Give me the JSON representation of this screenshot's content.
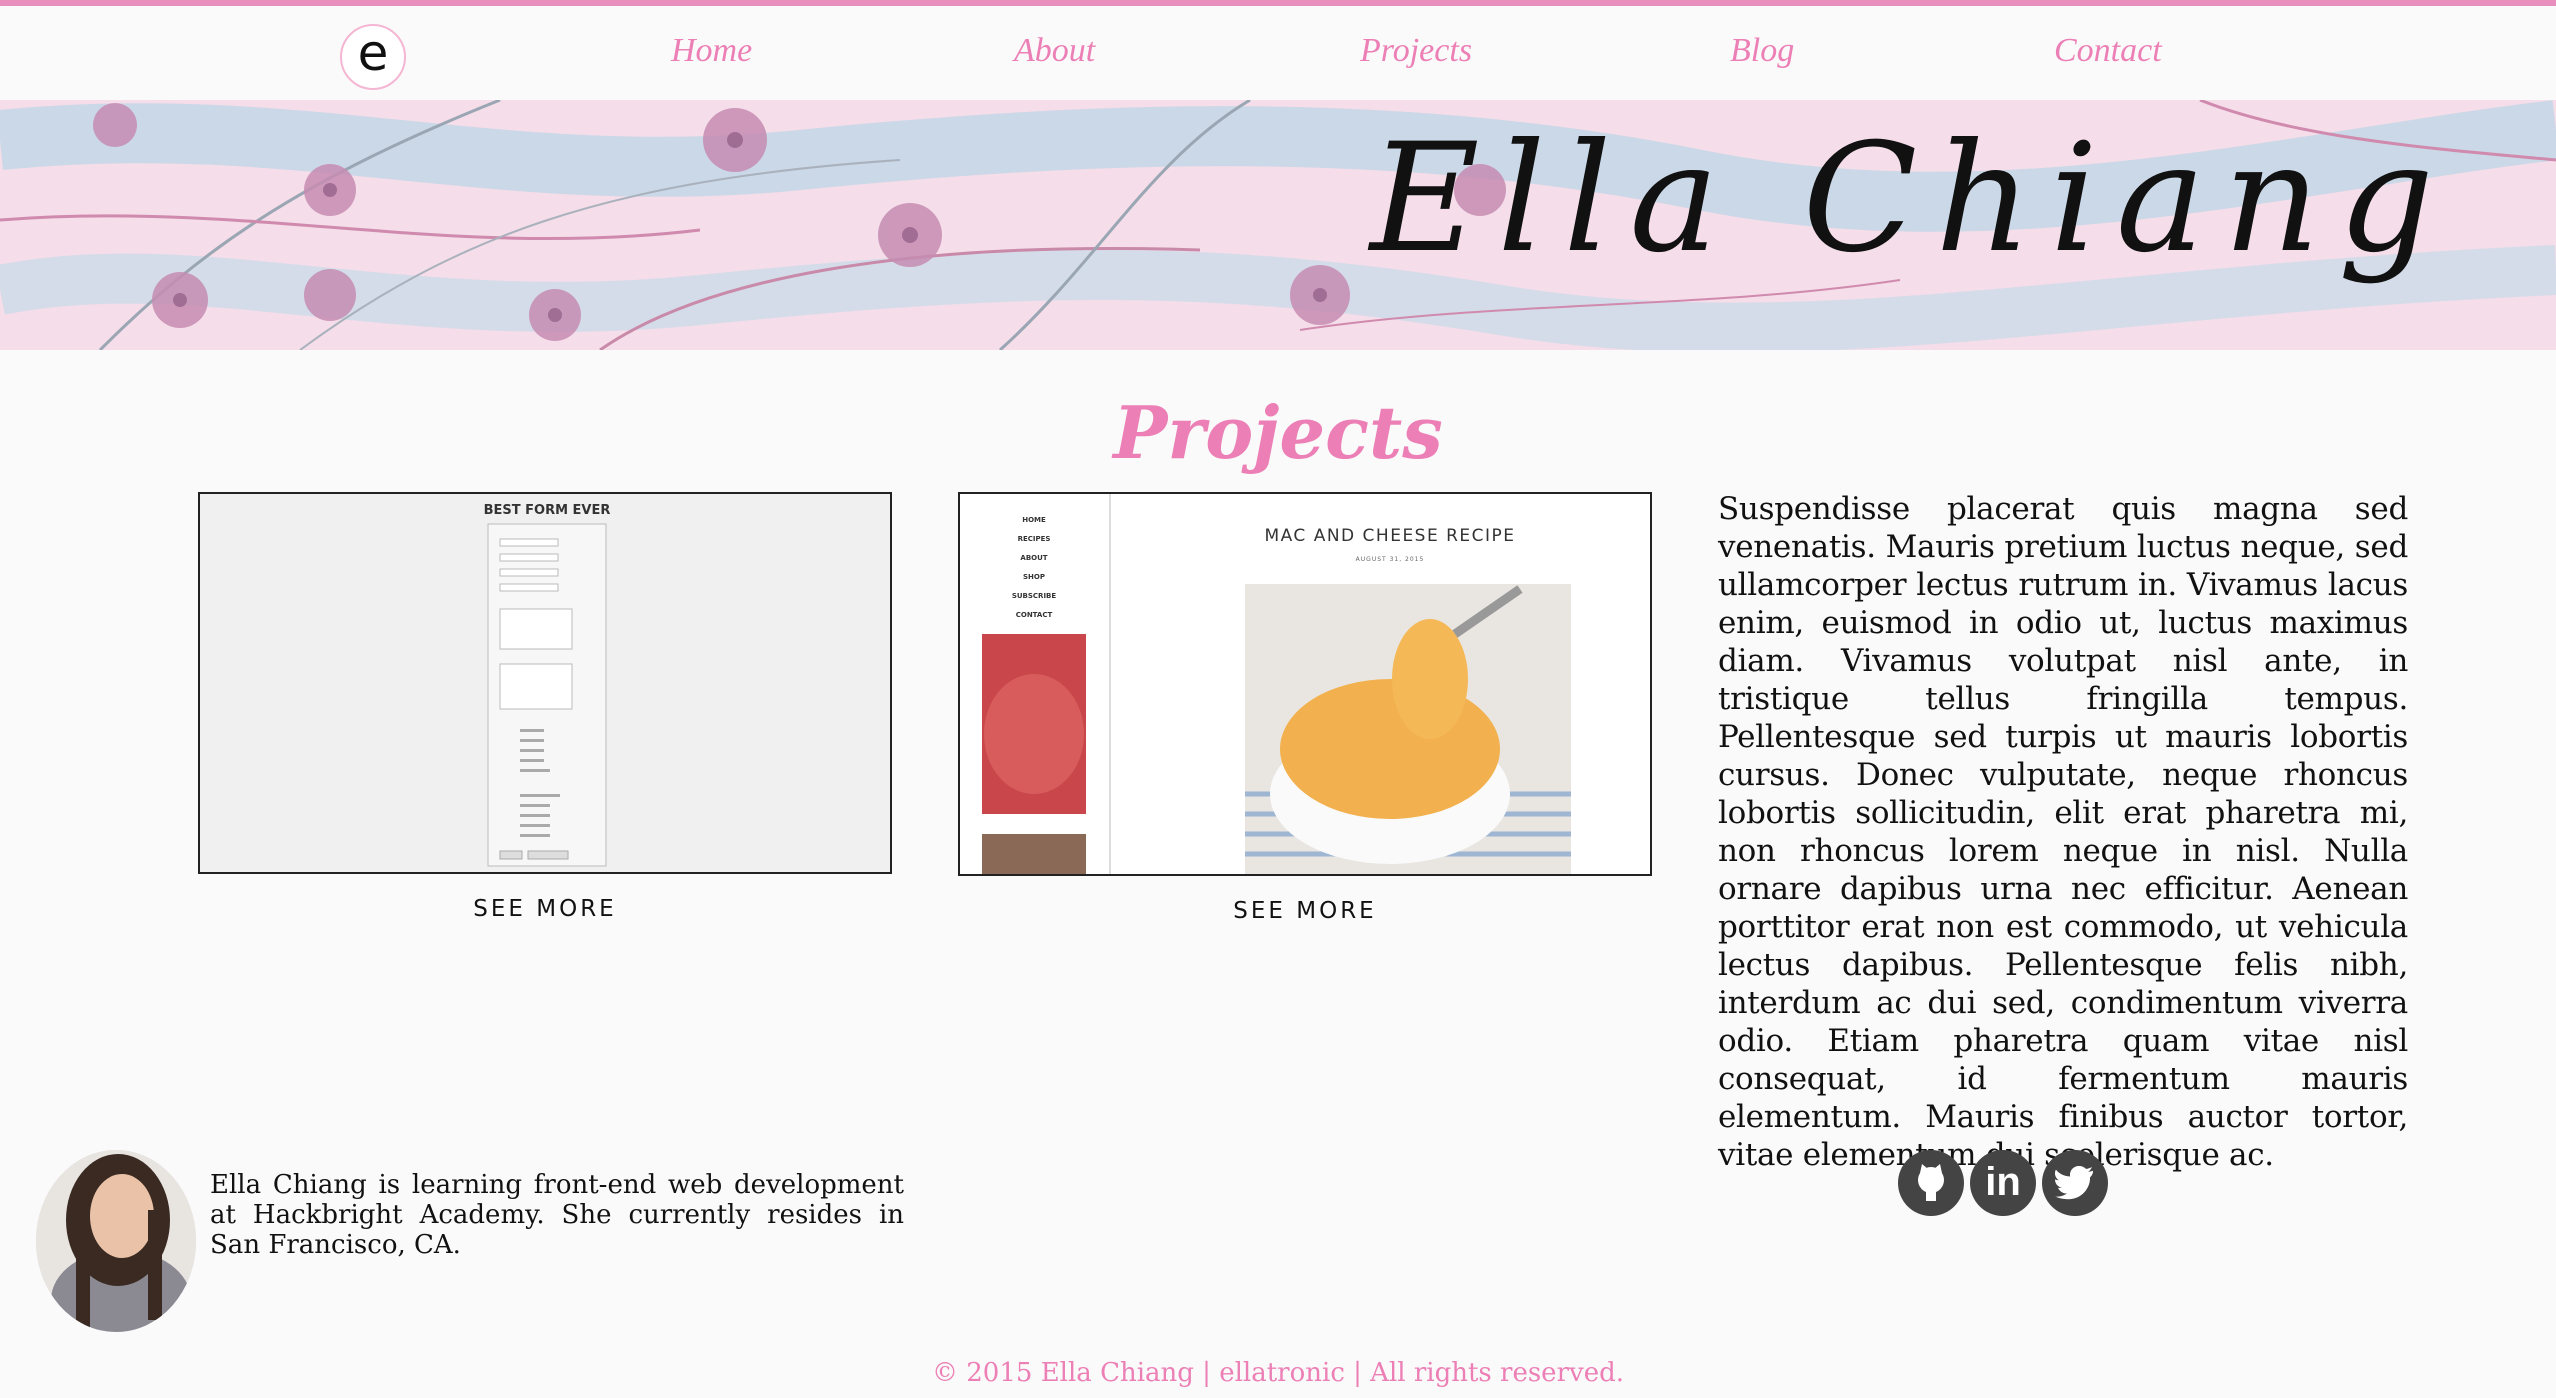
{
  "logo": {
    "letter": "e"
  },
  "nav": {
    "items": [
      {
        "label": "Home"
      },
      {
        "label": "About"
      },
      {
        "label": "Projects"
      },
      {
        "label": "Blog"
      },
      {
        "label": "Contact"
      }
    ]
  },
  "banner": {
    "name": "Ella Chiang"
  },
  "main": {
    "title": "Projects",
    "projects": [
      {
        "form_title": "BEST FORM EVER",
        "see_more": "SEE MORE"
      },
      {
        "recipe_title": "MAC AND CHEESE RECIPE",
        "recipe_date": "AUGUST 31, 2015",
        "menu": [
          "HOME",
          "RECIPES",
          "ABOUT",
          "SHOP",
          "SUBSCRIBE",
          "CONTACT"
        ],
        "see_more": "SEE MORE"
      }
    ],
    "paragraph": "Suspendisse placerat quis magna sed venenatis. Mauris pretium luctus neque, sed ullamcorper lectus rutrum in. Vivamus lacus enim, euismod in odio ut, luctus maximus diam. Vivamus volutpat nisl ante, in tristique tellus fringilla tempus. Pellentesque sed turpis ut mauris lobortis cursus. Donec vulputate, neque rhoncus lobortis sollicitudin, elit erat pharetra mi, non rhoncus lorem neque in nisl. Nulla ornare dapibus urna nec efficitur. Aenean porttitor erat non est commodo, ut vehicula lectus dapibus. Pellentesque felis nibh, interdum ac dui sed, condimentum viverra odio. Etiam pharetra quam vitae nisl consequat, id fermentum mauris elementum. Mauris finibus auctor tortor, vitae elementum dui scelerisque ac."
  },
  "bio": {
    "text": "Ella Chiang is learning front-end web development at Hackbright Academy. She currently resides in San Francisco, CA."
  },
  "social": {
    "icons": [
      "github-icon",
      "linkedin-icon",
      "twitter-icon"
    ],
    "linkedin_text": "in"
  },
  "footer": {
    "text": "© 2015 Ella Chiang | ellatronic | All rights reserved."
  },
  "colors": {
    "accent": "#ec7fb5",
    "top_line": "#e98fbd",
    "social_bg": "#444444",
    "background": "#fafafa"
  }
}
